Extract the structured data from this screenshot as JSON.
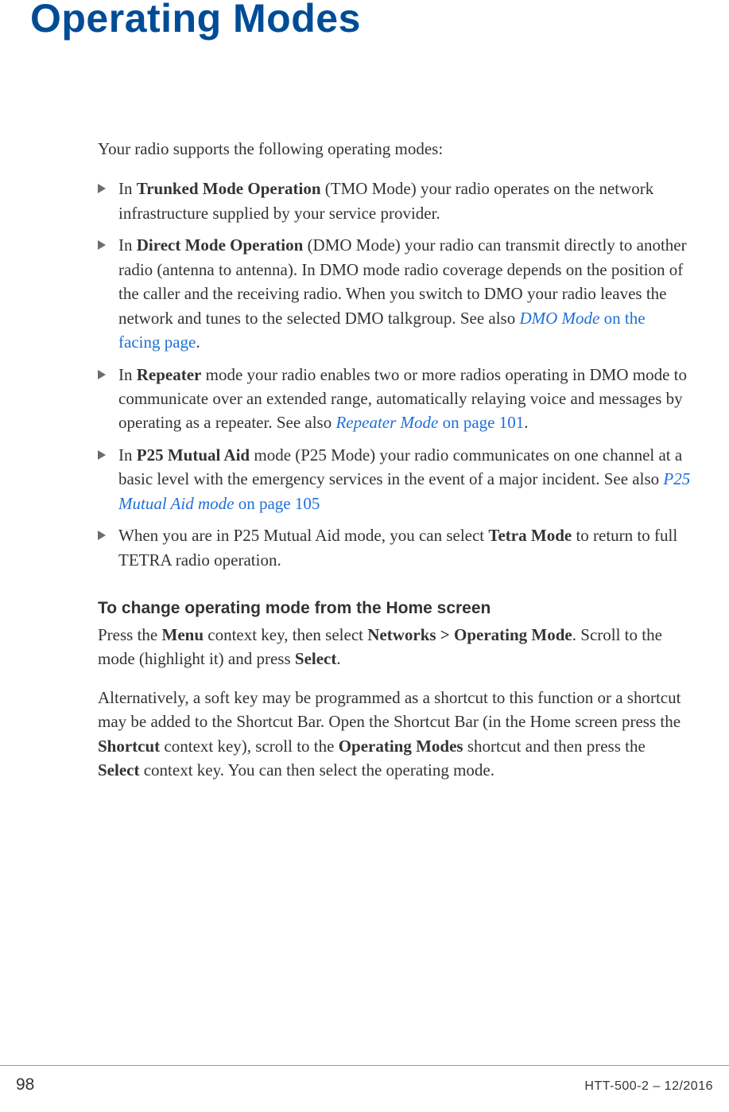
{
  "title": "Operating Modes",
  "intro": "Your radio supports the following operating modes:",
  "bullets": {
    "b0": {
      "p1": "In ",
      "s1": "Trunked Mode Operation",
      "p2": " (TMO Mode) your radio operates on the network infrastructure supplied by your service provider."
    },
    "b1": {
      "p1": "In ",
      "s1": "Direct Mode Operation",
      "p2": " (DMO Mode) your radio can transmit directly to another radio (antenna to antenna). In DMO mode radio coverage depends on the position of the caller and the receiving radio. When you switch to DMO your radio leaves the network and tunes to the selected DMO talkgroup. See also ",
      "link1": "DMO Mode",
      "link1b": " on the facing page",
      "p3": "."
    },
    "b2": {
      "p1": "In ",
      "s1": "Repeater",
      "p2": " mode your radio enables two or more radios operating in DMO mode to communicate over an extended range, automatically relaying voice and messages by operating as a repeater. See also ",
      "link1": "Repeater Mode",
      "link1b": " on page 101",
      "p3": "."
    },
    "b3": {
      "p1": "In ",
      "s1": "P25 Mutual Aid",
      "p2": " mode (P25 Mode) your radio communicates on one channel at a basic level with the emergency services in the event of a major incident. See also ",
      "link1": "P25 Mutual Aid mode",
      "link1b": " on page 105"
    },
    "b4": {
      "p1": "When you are in P25 Mutual Aid mode, you can select ",
      "s1": "Tetra Mode",
      "p2": " to return to full TETRA radio operation."
    }
  },
  "change": {
    "heading": "To change operating mode from the Home screen",
    "para1": {
      "t1": "Press the ",
      "b1": "Menu",
      "t2": " context key, then select ",
      "b2": "Networks > Operating Mode",
      "t3": ". Scroll to the mode (highlight it) and press ",
      "b3": "Select",
      "t4": "."
    },
    "para2": {
      "t1": "Alternatively, a soft key may be programmed as a shortcut to this function or a shortcut may be added to the Shortcut Bar. Open the Shortcut Bar (in the Home screen press the ",
      "b1": "Shortcut",
      "t2": " context key), scroll to the ",
      "b2": "Operating Modes",
      "t3": " shortcut and then press the ",
      "b3": "Select",
      "t4": " context key. You can then select the operating mode."
    }
  },
  "footer": {
    "page": "98",
    "docid": "HTT-500-2 – 12/2016"
  }
}
